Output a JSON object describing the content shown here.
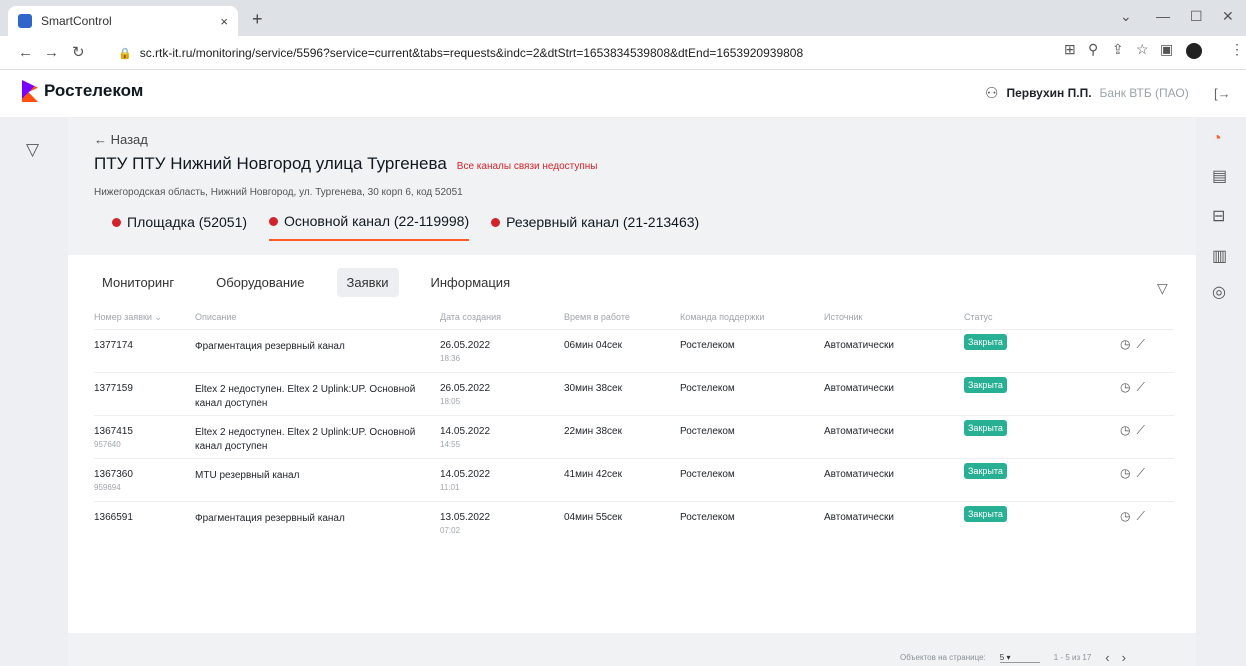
{
  "browser": {
    "tab_title": "SmartControl",
    "url": "sc.rtk-it.ru/monitoring/service/5596?service=current&tabs=requests&indc=2&dtStrt=1653834539808&dtEnd=1653920939808"
  },
  "app": {
    "logo": "Ростелеком",
    "user_name": "Первухин П.П.",
    "org": "Банк ВТБ (ПАО)"
  },
  "page": {
    "back": "← Назад",
    "title": "ПТУ ПТУ Нижний Новгород улица Тургенева",
    "warning": "Все каналы связи недоступны",
    "address": "Нижегородская область, Нижний Новгород, ул. Тургенева, 30 корп 6, код 52051"
  },
  "channels": [
    "Площадка (52051)",
    "Основной канал (22-119998)",
    "Резервный канал (21-213463)"
  ],
  "subtabs": [
    "Мониторинг",
    "Оборудование",
    "Заявки",
    "Информация"
  ],
  "columns": [
    "Номер заявки ⌄",
    "Описание",
    "Дата создания",
    "Время в работе",
    "Команда поддержки",
    "Источник",
    "Статус"
  ],
  "rows": [
    {
      "id": "1377174",
      "id2": "",
      "desc": "Фрагментация резервный канал",
      "date": "26.05.2022",
      "time": "18:36",
      "dur": "06мин 04сек",
      "team": "Ростелеком",
      "src": "Автоматически",
      "status": "Закрыта"
    },
    {
      "id": "1377159",
      "id2": "",
      "desc": "Eltex 2 недоступен. Eltex 2 Uplink:UP. Основной канал доступен",
      "date": "26.05.2022",
      "time": "18:05",
      "dur": "30мин 38сек",
      "team": "Ростелеком",
      "src": "Автоматически",
      "status": "Закрыта"
    },
    {
      "id": "1367415",
      "id2": "957640",
      "desc": "Eltex 2 недоступен. Eltex 2 Uplink:UP. Основной канал доступен",
      "date": "14.05.2022",
      "time": "14:55",
      "dur": "22мин 38сек",
      "team": "Ростелеком",
      "src": "Автоматически",
      "status": "Закрыта"
    },
    {
      "id": "1367360",
      "id2": "959694",
      "desc": "MTU резервный канал",
      "date": "14.05.2022",
      "time": "11:01",
      "dur": "41мин 42сек",
      "team": "Ростелеком",
      "src": "Автоматически",
      "status": "Закрыта"
    },
    {
      "id": "1366591",
      "id2": "",
      "desc": "Фрагментация резервный канал",
      "date": "13.05.2022",
      "time": "07:02",
      "dur": "04мин 55сек",
      "team": "Ростелеком",
      "src": "Автоматически",
      "status": "Закрыта"
    }
  ],
  "pager": {
    "label": "Объектов на странице:",
    "per_page": "5",
    "range": "1 - 5 из 17"
  }
}
